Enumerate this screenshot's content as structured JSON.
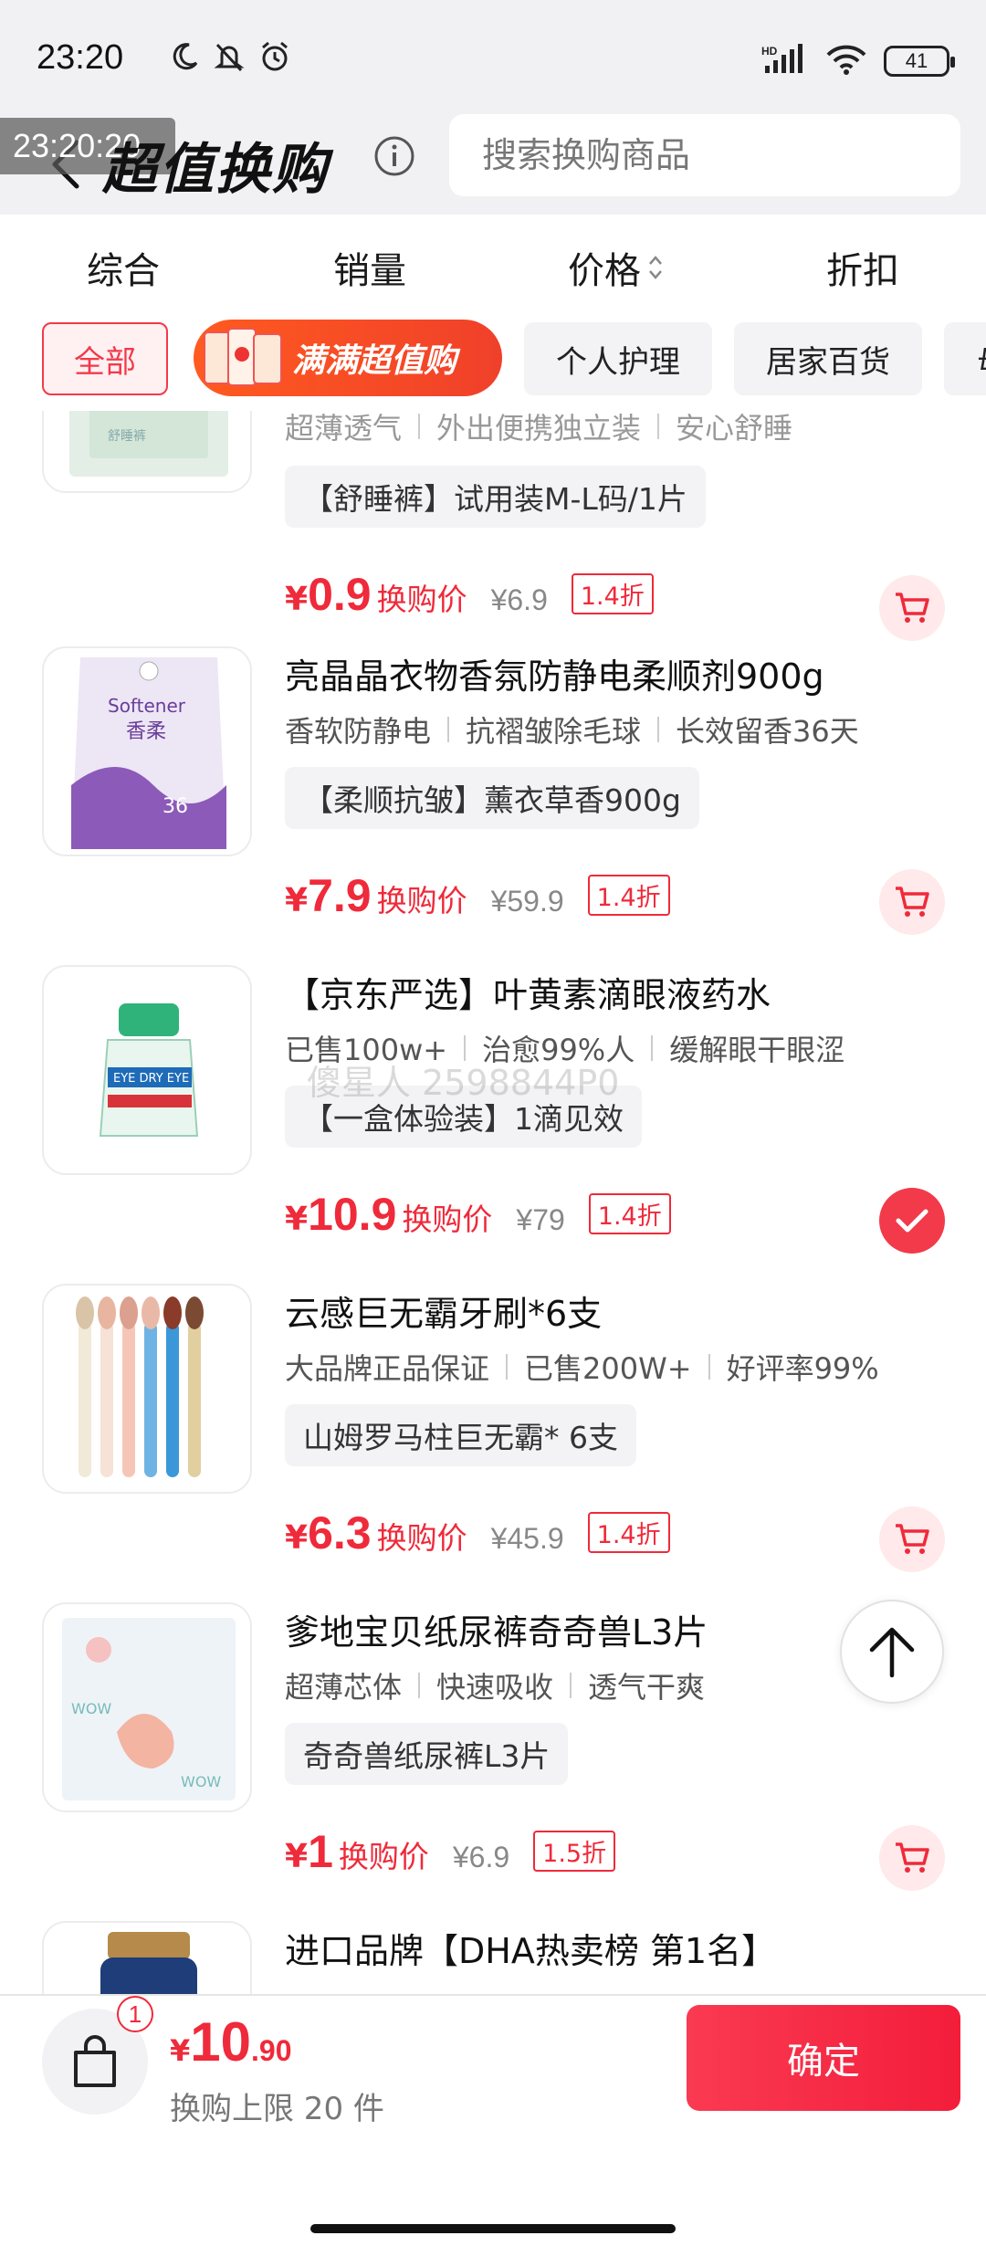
{
  "status_bar": {
    "time": "23:20",
    "network": "HD",
    "battery": "41"
  },
  "header": {
    "time_overlay": "23:20:20",
    "title": "超值换购",
    "search_placeholder": "搜索换购商品"
  },
  "sort_tabs": [
    {
      "label": "综合"
    },
    {
      "label": "销量"
    },
    {
      "label": "价格"
    },
    {
      "label": "折扣"
    }
  ],
  "categories": {
    "all": "全部",
    "promo": "满满超值购",
    "personal_care": "个人护理",
    "home_goods": "居家百货",
    "partial": "母"
  },
  "products": [
    {
      "title": "超薄透气 | 外出便携独立装 | 安心舒睡",
      "tags": [
        "超薄透气",
        "外出便携独立装",
        "安心舒睡"
      ],
      "spec": "【舒睡裤】试用装M-L码/1片",
      "price": "0.9",
      "price_label": "换购价",
      "original_price": "¥6.9",
      "discount": "1.4折",
      "selected": false
    },
    {
      "title": "亮晶晶衣物香氛防静电柔顺剂900g",
      "tags": [
        "香软防静电",
        "抗褶皱除毛球",
        "长效留香36天"
      ],
      "spec": "【柔顺抗皱】薰衣草香900g",
      "price": "7.9",
      "price_label": "换购价",
      "original_price": "¥59.9",
      "discount": "1.4折",
      "selected": false
    },
    {
      "title": "【京东严选】叶黄素滴眼液药水",
      "tags": [
        "已售100w+",
        "治愈99%人",
        "缓解眼干眼涩"
      ],
      "spec": "【一盒体验装】1滴见效",
      "price": "10.9",
      "price_label": "换购价",
      "original_price": "¥79",
      "discount": "1.4折",
      "selected": true
    },
    {
      "title": "云感巨无霸牙刷*6支",
      "tags": [
        "大品牌正品保证",
        "已售200W+",
        "好评率99%"
      ],
      "spec": "山姆罗马柱巨无霸* 6支",
      "price": "6.3",
      "price_label": "换购价",
      "original_price": "¥45.9",
      "discount": "1.4折",
      "selected": false
    },
    {
      "title": "爹地宝贝纸尿裤奇奇兽L3片",
      "tags": [
        "超薄芯体",
        "快速吸收",
        "透气干爽"
      ],
      "spec": "奇奇兽纸尿裤L3片",
      "price": "1",
      "price_label": "换购价",
      "original_price": "¥6.9",
      "discount": "1.5折",
      "selected": false
    },
    {
      "title": "进口品牌【DHA热卖榜 第1名】"
    }
  ],
  "watermark": "傻星人 2598844P0",
  "bottom_bar": {
    "badge_count": "1",
    "currency": "¥",
    "total_int": "10",
    "total_dec": ".90",
    "limit_text": "换购上限 20 件",
    "confirm_label": "确定"
  },
  "colors": {
    "accent": "#ef2a3a",
    "header_bg": "#f1f1f3",
    "chip_bg": "#f3f3f5"
  },
  "icons": [
    "moon-icon",
    "mute-icon",
    "alarm-icon",
    "signal-icon",
    "wifi-icon",
    "back-icon",
    "info-icon",
    "sort-arrows-icon",
    "cart-icon",
    "check-icon",
    "arrow-up-icon",
    "shopping-bag-icon"
  ]
}
